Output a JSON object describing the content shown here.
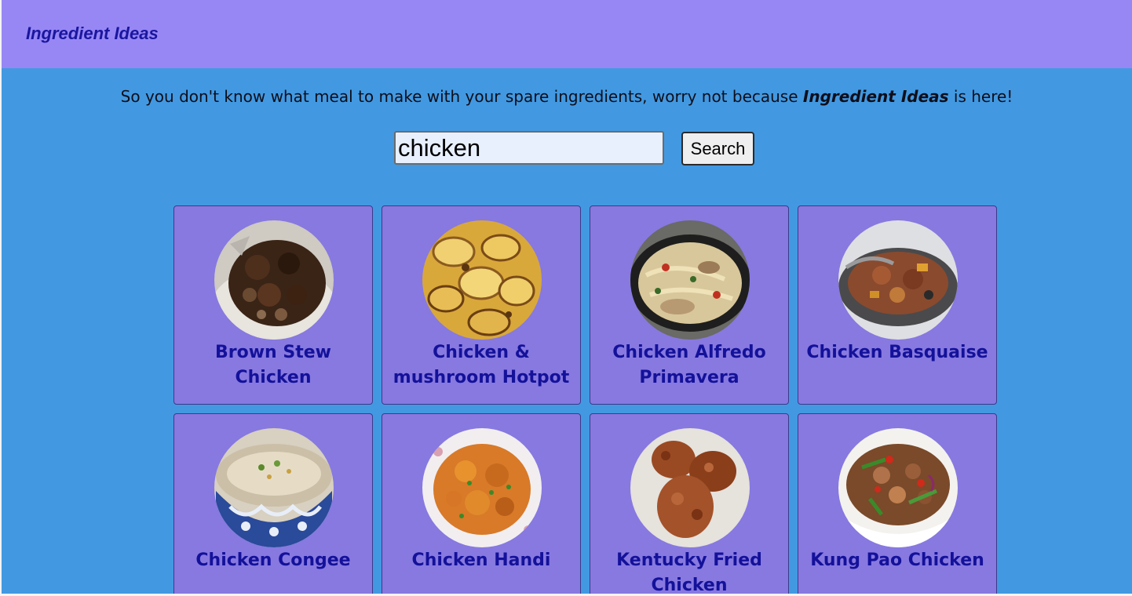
{
  "header": {
    "brand": "Ingredient Ideas"
  },
  "intro": {
    "text_before": "So you don't know what meal to make with your spare ingredients, worry not because ",
    "brand_emphasis": "Ingredient Ideas",
    "text_after": " is here!"
  },
  "search": {
    "value": "chicken",
    "button_label": "Search"
  },
  "meals": [
    {
      "name": "Brown Stew Chicken",
      "photo": "brown-stew-chicken-photo"
    },
    {
      "name": "Chicken & mushroom Hotpot",
      "photo": "chicken-mushroom-hotpot-photo"
    },
    {
      "name": "Chicken Alfredo Primavera",
      "photo": "chicken-alfredo-primavera-photo"
    },
    {
      "name": "Chicken Basquaise",
      "photo": "chicken-basquaise-photo"
    },
    {
      "name": "Chicken Congee",
      "photo": "chicken-congee-photo"
    },
    {
      "name": "Chicken Handi",
      "photo": "chicken-handi-photo"
    },
    {
      "name": "Kentucky Fried Chicken",
      "photo": "kentucky-fried-chicken-photo"
    },
    {
      "name": "Kung Pao Chicken",
      "photo": "kung-pao-chicken-photo"
    }
  ],
  "colors": {
    "header_bg": "#9787f5",
    "page_bg": "#4299e1",
    "card_bg": "#8779e0",
    "title_text": "#14119a"
  }
}
